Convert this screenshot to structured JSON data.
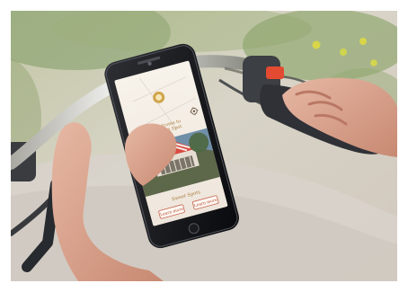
{
  "app": {
    "title_lines": [
      "Welcome to",
      "Sweet Spot"
    ],
    "section_label": "Sweet Spots",
    "buttons": [
      {
        "label": "Learn more"
      },
      {
        "label": "Learn more"
      }
    ]
  },
  "icons": {
    "logo": "badge-icon",
    "back": "back-arrow-icon",
    "settings": "gear-icon"
  }
}
